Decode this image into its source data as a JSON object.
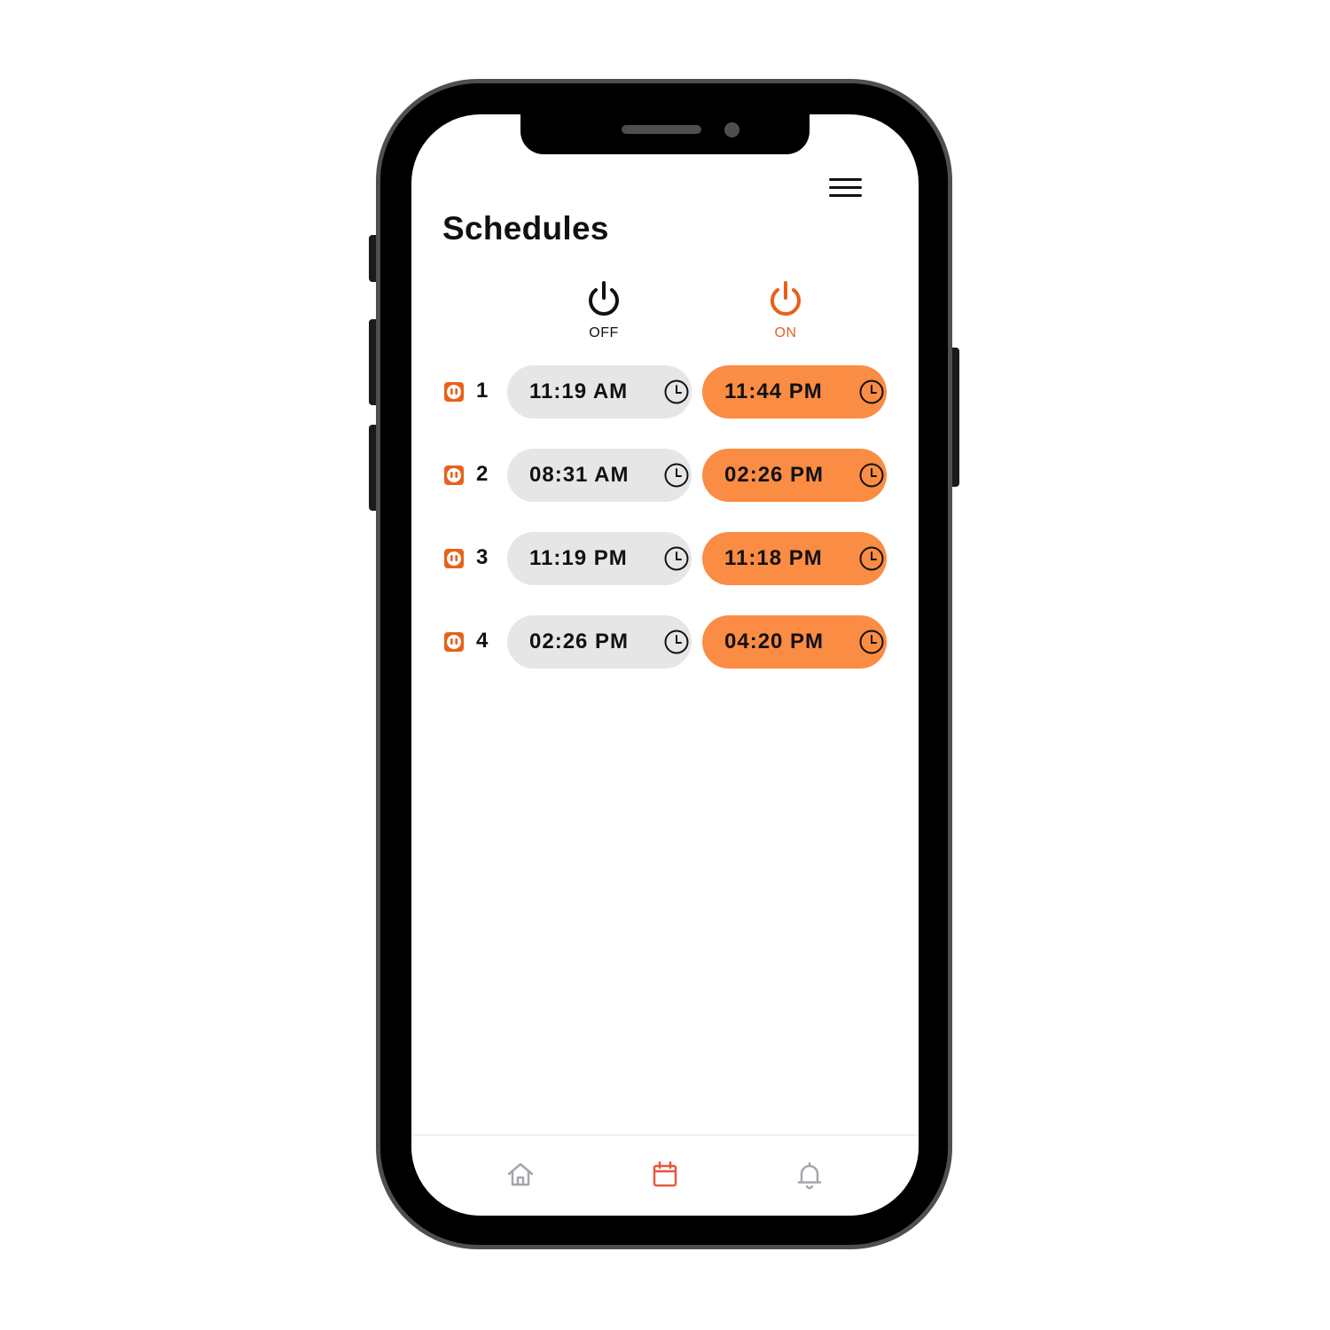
{
  "header": {
    "title": "Schedules"
  },
  "columns": {
    "off_label": "OFF",
    "on_label": "ON"
  },
  "colors": {
    "accent": "#e8611a",
    "on_pill": "#fb8c44",
    "off_pill": "#e6e6e6",
    "nav_inactive": "#a3a6ad",
    "nav_active": "#e8573d"
  },
  "schedules": [
    {
      "number": "1",
      "off_time": "11:19 AM",
      "on_time": "11:44 PM"
    },
    {
      "number": "2",
      "off_time": "08:31 AM",
      "on_time": "02:26 PM"
    },
    {
      "number": "3",
      "off_time": "11:19 PM",
      "on_time": "11:18 PM"
    },
    {
      "number": "4",
      "off_time": "02:26 PM",
      "on_time": "04:20 PM"
    }
  ],
  "icons": {
    "menu": "hamburger-icon",
    "off": "power-icon",
    "on": "power-icon",
    "row": "outlet-icon",
    "time": "clock-icon",
    "nav": [
      "home-icon",
      "calendar-icon",
      "bell-icon"
    ]
  },
  "bottom_nav": {
    "active": "schedules"
  }
}
